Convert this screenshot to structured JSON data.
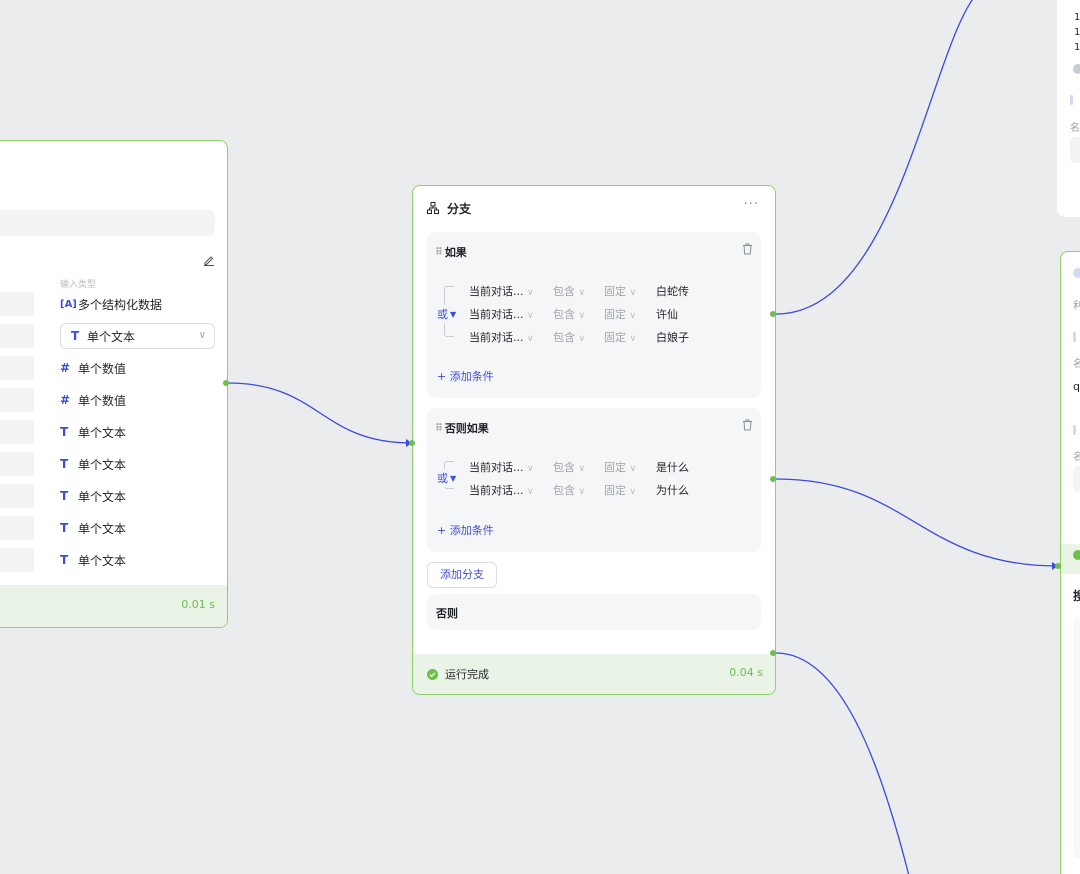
{
  "left_node": {
    "column_label": "输入类型",
    "select": {
      "icon": "text-type-icon",
      "label": "单个文本"
    },
    "types": [
      {
        "icon": "array-type-icon",
        "glyph": "[A]",
        "label": "多个结构化数据"
      },
      {
        "icon": "number-type-icon",
        "glyph": "#",
        "label": "单个数值"
      },
      {
        "icon": "number-type-icon",
        "glyph": "#",
        "label": "单个数值"
      },
      {
        "icon": "text-type-icon",
        "glyph": "T",
        "label": "单个文本"
      },
      {
        "icon": "text-type-icon",
        "glyph": "T",
        "label": "单个文本"
      },
      {
        "icon": "text-type-icon",
        "glyph": "T",
        "label": "单个文本"
      },
      {
        "icon": "text-type-icon",
        "glyph": "T",
        "label": "单个文本"
      },
      {
        "icon": "text-type-icon",
        "glyph": "T",
        "label": "单个文本"
      }
    ],
    "time": "0.01 s"
  },
  "branch_node": {
    "title": "分支",
    "more": "···",
    "if_block": {
      "title": "如果",
      "logic": "或",
      "conditions": [
        {
          "variable": "当前对话...",
          "operator": "包含",
          "kind": "固定",
          "value": "白蛇传"
        },
        {
          "variable": "当前对话...",
          "operator": "包含",
          "kind": "固定",
          "value": "许仙"
        },
        {
          "variable": "当前对话...",
          "operator": "包含",
          "kind": "固定",
          "value": "白娘子"
        }
      ],
      "add_condition": "+ 添加条件"
    },
    "elif_block": {
      "title": "否则如果",
      "logic": "或",
      "conditions": [
        {
          "variable": "当前对话...",
          "operator": "包含",
          "kind": "固定",
          "value": "是什么"
        },
        {
          "variable": "当前对话...",
          "operator": "包含",
          "kind": "固定",
          "value": "为什么"
        }
      ],
      "add_condition": "+ 添加条件"
    },
    "add_branch": "添加分支",
    "else_label": "否则",
    "status": "运行完成",
    "time": "0.04 s"
  },
  "right_top": {
    "lines": [
      "1",
      "1",
      "1"
    ],
    "label": "名"
  },
  "right_bottom": {
    "title_frag": "利",
    "label1": "名",
    "value1": "q",
    "label2": "名",
    "title2": "搜"
  },
  "colors": {
    "accent": "#3d4ed6",
    "edge": "#3a4bdc",
    "success": "#6bbf4a",
    "node_border": "#8dd16a",
    "canvas": "#ebecee"
  }
}
